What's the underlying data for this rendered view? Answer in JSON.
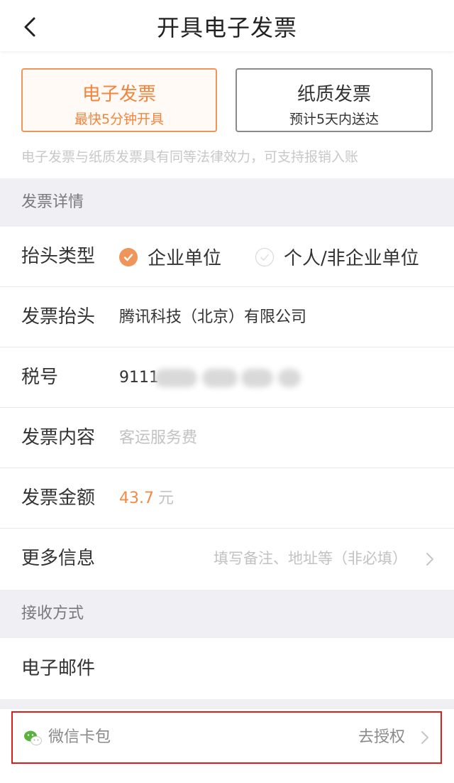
{
  "header": {
    "title": "开具电子发票"
  },
  "invoice_type": {
    "electronic": {
      "title": "电子发票",
      "subtitle": "最快5分钟开具"
    },
    "paper": {
      "title": "纸质发票",
      "subtitle": "预计5天内送达"
    },
    "notice": "电子发票与纸质发票具有同等法律效力，可支持报销入账"
  },
  "details": {
    "section_title": "发票详情",
    "header_type": {
      "label": "抬头类型",
      "option_company": "企业单位",
      "option_personal": "个人/非企业单位",
      "selected": "企业单位"
    },
    "invoice_header": {
      "label": "发票抬头",
      "value": "腾讯科技（北京）有限公司"
    },
    "tax_id": {
      "label": "税号",
      "value_prefix": "9111"
    },
    "content": {
      "label": "发票内容",
      "placeholder": "客运服务费"
    },
    "amount": {
      "label": "发票金额",
      "value": "43.7",
      "unit": "元"
    },
    "more": {
      "label": "更多信息",
      "placeholder": "填写备注、地址等（非必填）"
    }
  },
  "receive": {
    "section_title": "接收方式",
    "email": {
      "label": "电子邮件"
    },
    "wechat": {
      "label": "微信卡包",
      "action": "去授权"
    }
  },
  "colors": {
    "accent": "#f0955a",
    "highlight_border": "#e01d1d",
    "wechat_green": "#5ab23c"
  }
}
